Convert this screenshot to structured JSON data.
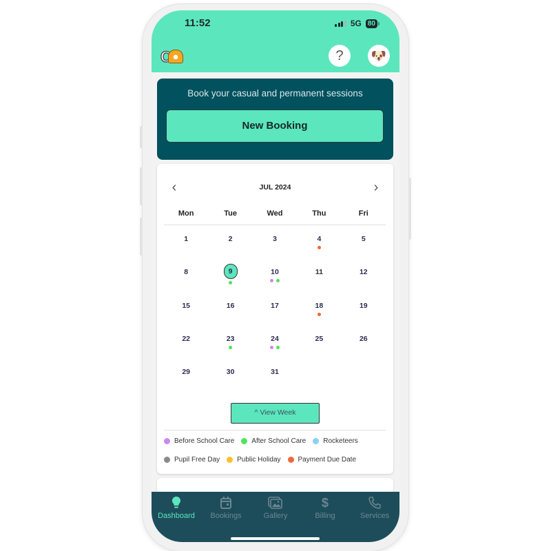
{
  "status_bar": {
    "time": "11:52",
    "network": "5G",
    "battery": "80"
  },
  "header": {
    "logo_text": "CA",
    "help_icon": "question-icon",
    "avatar_icon": "dog-face-icon",
    "avatar_glyph": "🐶",
    "help_glyph": "?"
  },
  "booking": {
    "prompt": "Book your casual and permanent sessions",
    "button_label": "New Booking"
  },
  "calendar": {
    "month_label": "JUL 2024",
    "prev_glyph": "‹",
    "next_glyph": "›",
    "weekdays": [
      "Mon",
      "Tue",
      "Wed",
      "Thu",
      "Fri"
    ],
    "selected_day": "9",
    "days": [
      {
        "d": "1",
        "dots": []
      },
      {
        "d": "2",
        "dots": []
      },
      {
        "d": "3",
        "dots": []
      },
      {
        "d": "4",
        "dots": [
          "payment"
        ]
      },
      {
        "d": "5",
        "dots": []
      },
      {
        "d": "8",
        "dots": []
      },
      {
        "d": "9",
        "dots": [
          "after"
        ]
      },
      {
        "d": "10",
        "dots": [
          "before",
          "after"
        ]
      },
      {
        "d": "11",
        "dots": []
      },
      {
        "d": "12",
        "dots": []
      },
      {
        "d": "15",
        "dots": []
      },
      {
        "d": "16",
        "dots": []
      },
      {
        "d": "17",
        "dots": []
      },
      {
        "d": "18",
        "dots": [
          "payment"
        ]
      },
      {
        "d": "19",
        "dots": []
      },
      {
        "d": "22",
        "dots": []
      },
      {
        "d": "23",
        "dots": [
          "after"
        ]
      },
      {
        "d": "24",
        "dots": [
          "before",
          "after"
        ]
      },
      {
        "d": "25",
        "dots": []
      },
      {
        "d": "26",
        "dots": []
      },
      {
        "d": "29",
        "dots": []
      },
      {
        "d": "30",
        "dots": []
      },
      {
        "d": "31",
        "dots": []
      },
      {
        "d": "",
        "dots": []
      },
      {
        "d": "",
        "dots": []
      }
    ],
    "view_week_label": "^ View Week"
  },
  "legend": [
    {
      "key": "before",
      "label": "Before School Care",
      "color": "#cc88f0"
    },
    {
      "key": "after",
      "label": "After School Care",
      "color": "#4ee45a"
    },
    {
      "key": "rocketeers",
      "label": "Rocketeers",
      "color": "#8ad0f5"
    },
    {
      "key": "pupil",
      "label": "Pupil Free Day",
      "color": "#8a8a8a"
    },
    {
      "key": "holiday",
      "label": "Public Holiday",
      "color": "#fbc02d"
    },
    {
      "key": "payment",
      "label": "Payment Due Date",
      "color": "#f0683a"
    }
  ],
  "tabbar": {
    "items": [
      {
        "label": "Dashboard",
        "icon": "lightbulb-icon",
        "active": true
      },
      {
        "label": "Bookings",
        "icon": "calendar-icon",
        "active": false
      },
      {
        "label": "Gallery",
        "icon": "gallery-icon",
        "active": false
      },
      {
        "label": "Billing",
        "icon": "dollar-icon",
        "active": false
      },
      {
        "label": "Services",
        "icon": "phone-icon",
        "active": false
      }
    ]
  }
}
